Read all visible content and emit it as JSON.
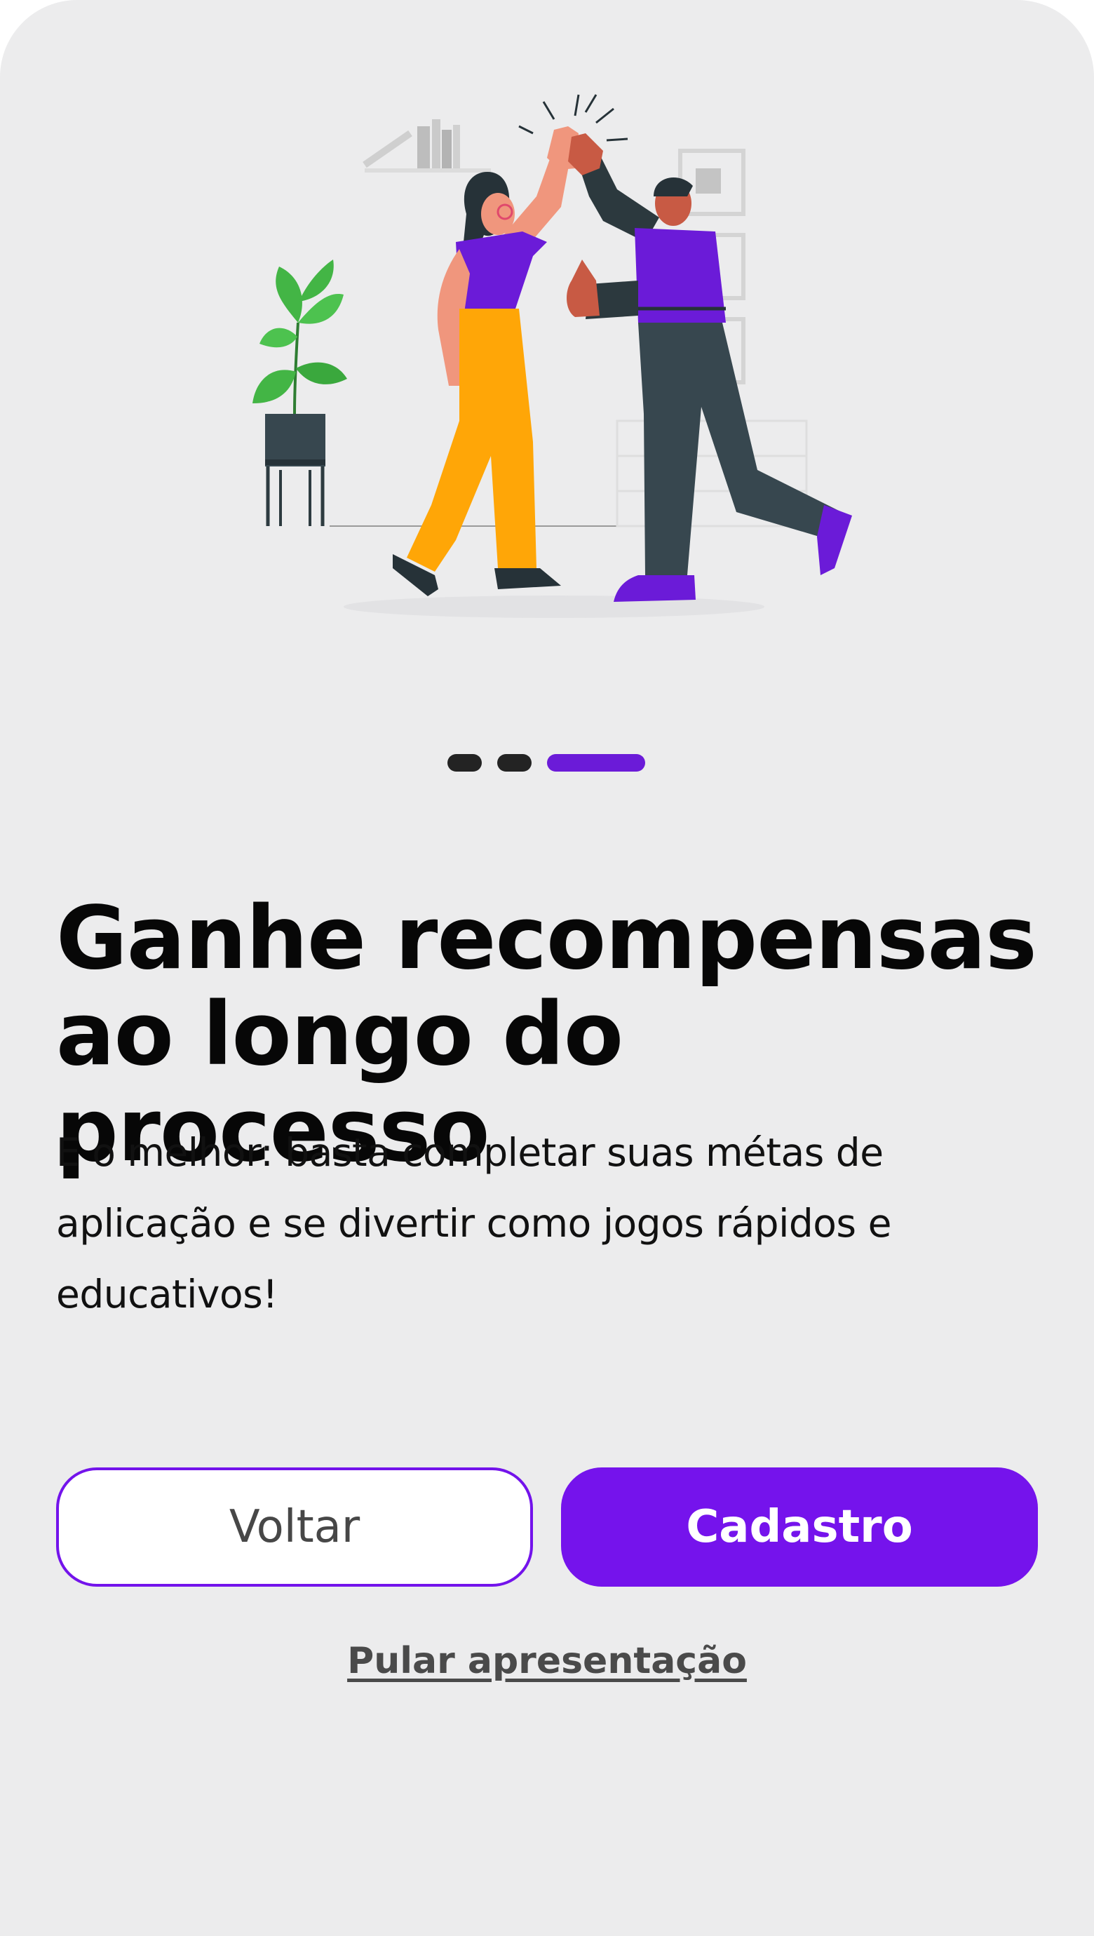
{
  "onboarding": {
    "illustration": "high-five-illustration",
    "pager": {
      "total": 3,
      "current": 3
    },
    "title_line1": "Ganhe recompensas",
    "title_line2": "ao longo do processo",
    "body_line1": "E o melhor: basta completar suas métas de",
    "body_line2": "aplicação e se divertir como jogos rápidos e",
    "body_line3": "educativos!",
    "back_label": "Voltar",
    "signup_label": "Cadastro",
    "skip_label": "Pular apresentação"
  },
  "colors": {
    "background": "#ececed",
    "accent": "#7513ec",
    "title": "#070707",
    "text": "#111111",
    "dot_inactive": "#232323"
  }
}
